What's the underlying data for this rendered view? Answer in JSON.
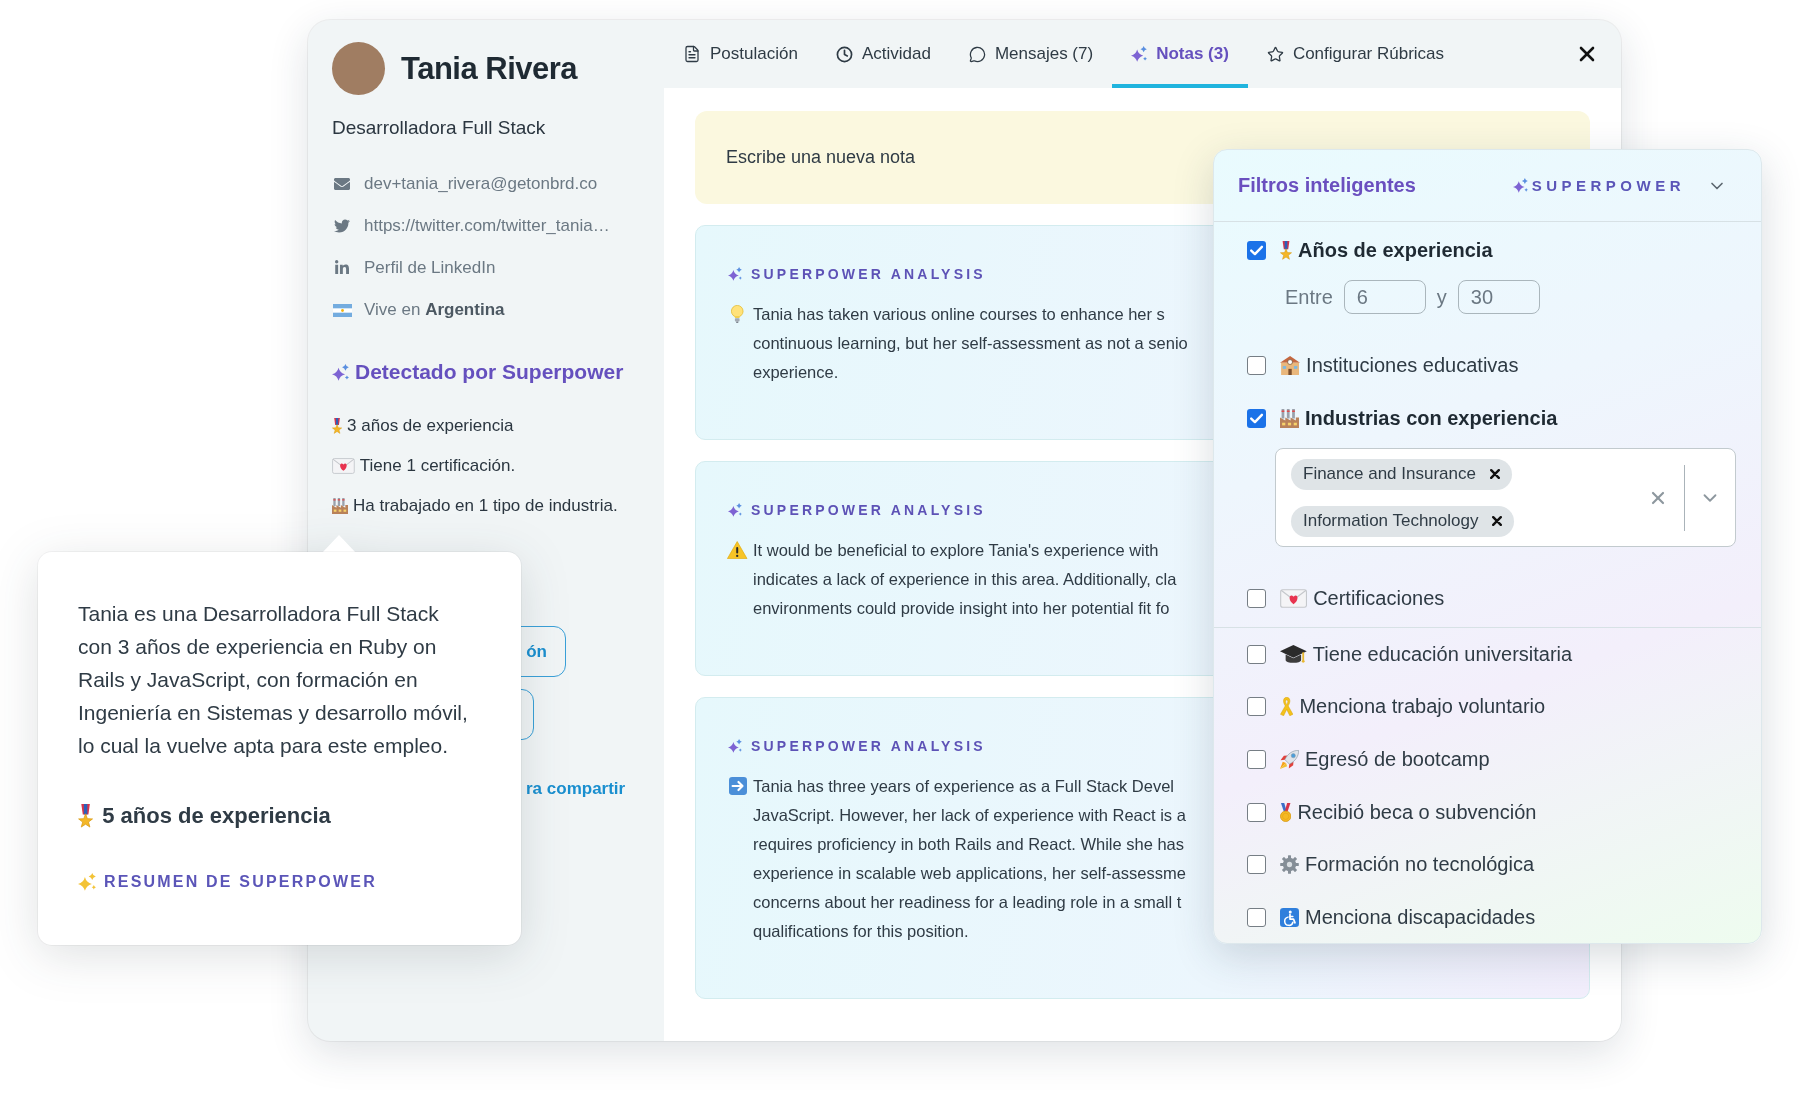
{
  "profile": {
    "name": "Tania Rivera",
    "role": "Desarrolladora Full Stack",
    "contacts": [
      {
        "kind": "email",
        "text": "dev+tania_rivera@getonbrd.co"
      },
      {
        "kind": "twitter",
        "text": "https://twitter.com/twitter_tania…"
      },
      {
        "kind": "linkedin",
        "text": "Perfil de LinkedIn"
      },
      {
        "kind": "location",
        "text": "Vive en **Argentina**"
      }
    ]
  },
  "detected": {
    "title": "Detectado por Superpower",
    "items": [
      {
        "kind": "experience",
        "text": "3 años de experiencia"
      },
      {
        "kind": "certification",
        "text": "Tiene 1 certificación."
      },
      {
        "kind": "industry",
        "text": "Ha trabajado en 1 tipo de industria."
      }
    ]
  },
  "actions": {
    "buttons": [
      {
        "kind": "labelled",
        "label": "ón"
      },
      {
        "kind": "blank"
      }
    ],
    "link": "ra compartir"
  },
  "tabs": [
    {
      "kind": "application",
      "label": "Postulación",
      "selected": false
    },
    {
      "kind": "activity",
      "label": "Actividad",
      "selected": false
    },
    {
      "kind": "messages",
      "label": "Mensajes (7)",
      "selected": false
    },
    {
      "kind": "notes",
      "label": "Notas (3)",
      "selected": true
    },
    {
      "kind": "rubrics",
      "label": "Configurar Rúbricas",
      "selected": false
    }
  ],
  "new_note": {
    "placeholder": "Escribe una nueva nota"
  },
  "notes": [
    {
      "kind": "insight",
      "header": "SUPERPOWER ANALYSIS",
      "lines": [
        "Tania has taken various online courses to enhance her s",
        "continuous learning, but her self-assessment as not a senio",
        "experience."
      ]
    },
    {
      "kind": "warning",
      "header": "SUPERPOWER ANALYSIS",
      "lines": [
        "It would be beneficial to explore Tania's experience with",
        "indicates a lack of experience in this area. Additionally, cla",
        "environments could provide insight into her potential fit fo"
      ]
    },
    {
      "kind": "summary",
      "header": "SUPERPOWER ANALYSIS",
      "lines": [
        "Tania has three years of experience as a Full Stack Devel",
        "JavaScript. However, her lack of experience with React is a",
        "requires proficiency in both Rails and React. While she has",
        "experience in scalable web applications, her self-assessme",
        "concerns about her readiness for a leading role in a small t",
        "qualifications for this position."
      ]
    }
  ],
  "smart_filters": {
    "title": "Filtros inteligentes",
    "badge": "SUPERPOWER",
    "groups": [
      {
        "filters": [
          {
            "kind": "experience",
            "checked": true,
            "label": "Años de experiencia",
            "range": {
              "from_label": "Entre",
              "from": "6",
              "to_label": "y",
              "to": "30"
            }
          },
          {
            "kind": "institutions",
            "checked": false,
            "label": "Instituciones educativas"
          },
          {
            "kind": "industries",
            "checked": true,
            "label": "Industrias con experiencia",
            "tags": [
              "Finance and Insurance",
              "Information Technology"
            ]
          },
          {
            "kind": "certifications",
            "checked": false,
            "label": "Certificaciones"
          }
        ]
      },
      {
        "filters": [
          {
            "kind": "university",
            "checked": false,
            "label": "Tiene educación universitaria"
          },
          {
            "kind": "volunteering",
            "checked": false,
            "label": "Menciona trabajo voluntario"
          },
          {
            "kind": "bootcamp",
            "checked": false,
            "label": "Egresó de bootcamp"
          },
          {
            "kind": "scholarship",
            "checked": false,
            "label": "Recibió beca o subvención"
          },
          {
            "kind": "nontechnical",
            "checked": false,
            "label": "Formación no tecnológica"
          },
          {
            "kind": "disability",
            "checked": false,
            "label": "Menciona discapacidades"
          }
        ]
      }
    ]
  },
  "summary_popover": {
    "text": "Tania es una Desarrolladora Full Stack con 3 años de experiencia en Ruby on Rails y JavaScript, con formación en Ingeniería en Sistemas y desarrollo móvil, lo cual la vuelve apta para este empleo.",
    "highlight": {
      "kind": "experience",
      "text": "5 años de experiencia"
    },
    "footer": "RESUMEN DE SUPERPOWER"
  }
}
